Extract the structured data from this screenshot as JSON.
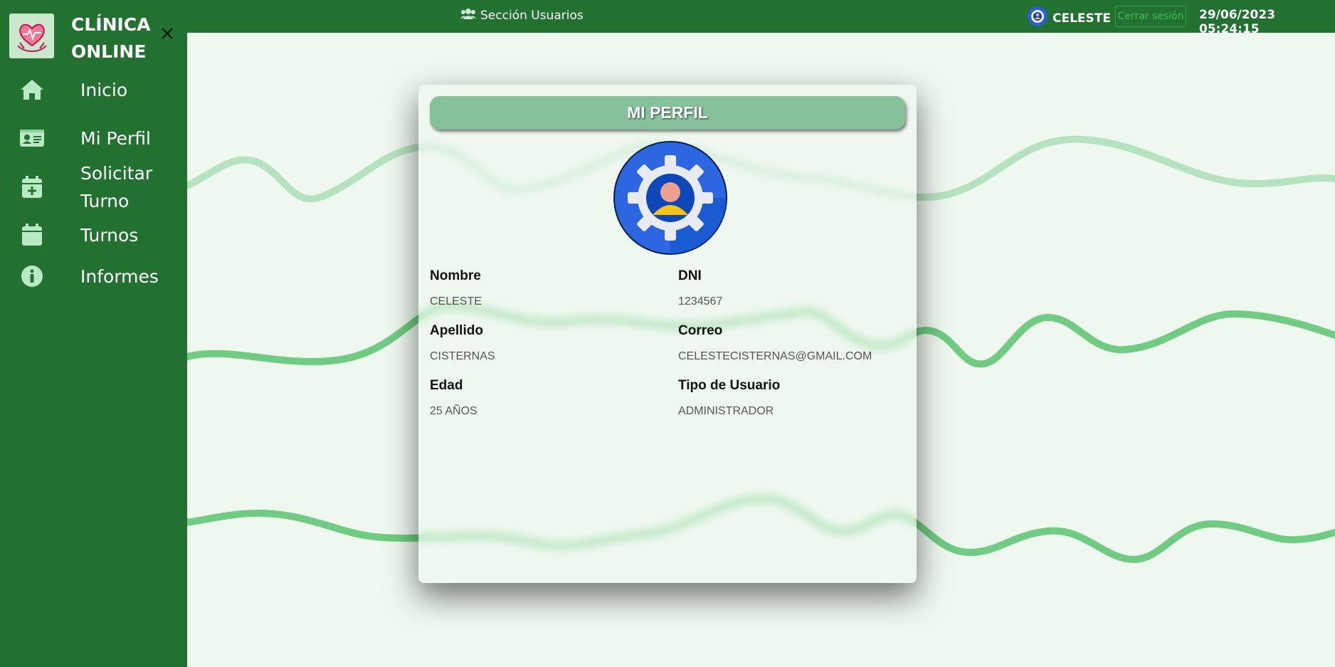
{
  "brand": {
    "title": "CLÍNICA ONLINE",
    "logo_icon": "heart-hands-icon"
  },
  "sidebar": {
    "items": [
      {
        "label": "Inicio",
        "icon": "home-icon"
      },
      {
        "label": "Mi Perfil",
        "icon": "id-card-icon"
      },
      {
        "label": "Solicitar Turno",
        "icon": "calendar-plus-icon"
      },
      {
        "label": "Turnos",
        "icon": "calendar-icon"
      },
      {
        "label": "Informes",
        "icon": "info-circle-icon"
      }
    ]
  },
  "topbar": {
    "section_title": "Sección Usuarios",
    "user_name": "CELESTE",
    "logout_label": "Cerrar sesión",
    "datetime": "29/06/2023 05:24:15"
  },
  "profile": {
    "title": "MI PERFIL",
    "fields": [
      {
        "label": "Nombre",
        "value": "CELESTE"
      },
      {
        "label": "DNI",
        "value": "1234567"
      },
      {
        "label": "Apellido",
        "value": "CISTERNAS"
      },
      {
        "label": "Correo",
        "value": "CELESTECISTERNAS@GMAIL.COM"
      },
      {
        "label": "Edad",
        "value": "25 AÑOS"
      },
      {
        "label": "Tipo de Usuario",
        "value": "ADMINISTRADOR"
      }
    ]
  },
  "colors": {
    "sidebar": "#227130",
    "background": "#eef8ef",
    "header_pill": "#86c19c",
    "wave_light": "#b6e3bf",
    "wave_dark": "#6fcc82"
  }
}
